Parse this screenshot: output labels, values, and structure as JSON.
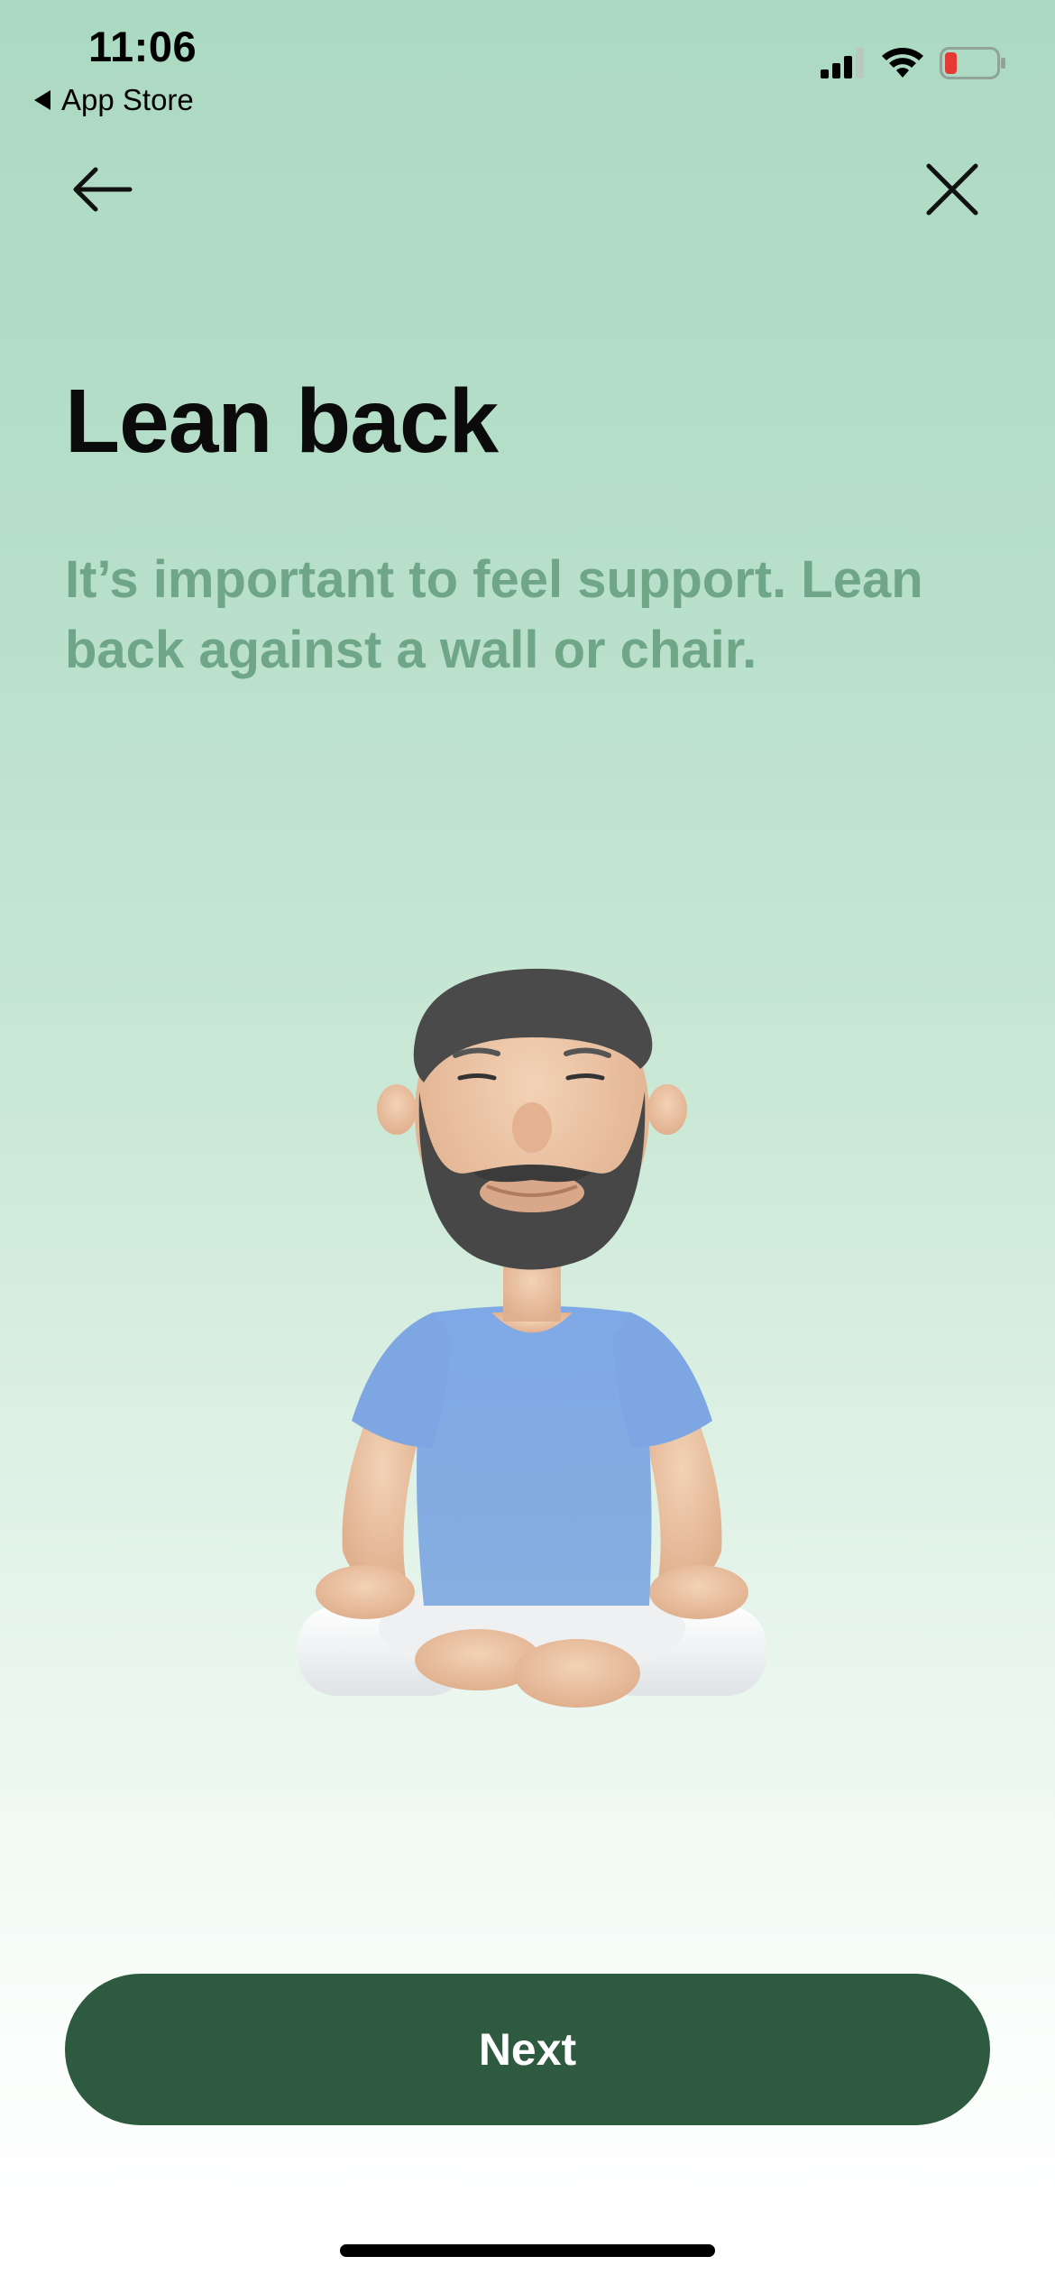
{
  "status_bar": {
    "time": "11:06",
    "back_app_label": "App Store",
    "signal_icon": "cellular-signal-icon",
    "wifi_icon": "wifi-icon",
    "battery_icon": "battery-low-icon",
    "battery_level_color": "#e53935"
  },
  "nav": {
    "back_icon": "arrow-left-icon",
    "close_icon": "close-icon"
  },
  "content": {
    "title": "Lean back",
    "subtitle": "It’s important to feel support. Lean back against a wall or chair."
  },
  "illustration": {
    "name": "meditating-man-illustration"
  },
  "footer": {
    "next_label": "Next"
  },
  "colors": {
    "accent": "#2e5a3f",
    "subtitle": "#6fa688",
    "background_top": "#acd9c2",
    "background_bottom": "#ffffff"
  }
}
